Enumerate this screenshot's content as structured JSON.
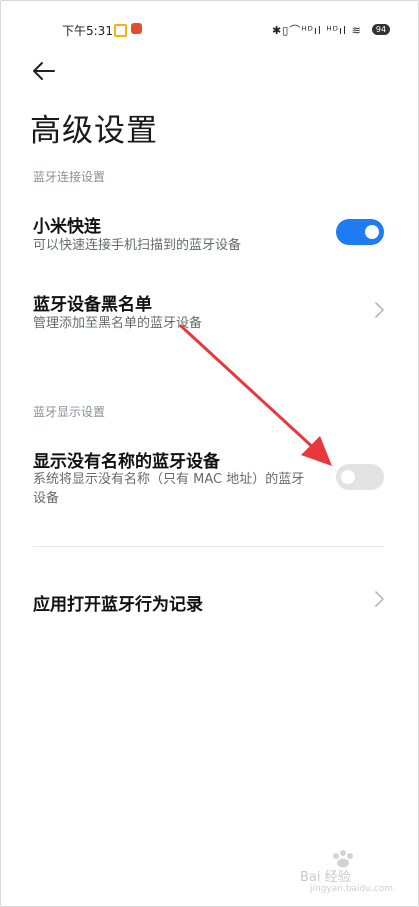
{
  "status_bar": {
    "time": "下午5:31",
    "right_text": "✱▯⌒ᴴᴰıl ᴴᴰıl ≋",
    "battery": "94"
  },
  "header": {
    "title": "高级设置"
  },
  "sections": {
    "bluetooth_connection": {
      "label": "蓝牙连接设置",
      "xiaomi_quick_connect": {
        "title": "小米快连",
        "subtitle": "可以快速连接手机扫描到的蓝牙设备",
        "enabled": true
      },
      "blacklist": {
        "title": "蓝牙设备黑名单",
        "subtitle": "管理添加至黑名单的蓝牙设备"
      }
    },
    "bluetooth_display": {
      "label": "蓝牙显示设置",
      "show_unnamed": {
        "title": "显示没有名称的蓝牙设备",
        "subtitle_line1": "系统将显示没有名称（只有 MAC 地址）的蓝牙",
        "subtitle_line2": "设备",
        "enabled": false
      }
    },
    "app_records": {
      "title": "应用打开蓝牙行为记录"
    }
  },
  "watermark": {
    "text": "Bai 经验",
    "sub": "jingyan.baidu.com"
  },
  "colors": {
    "accent": "#1f7bf2",
    "annotation_arrow": "#e8383d"
  }
}
